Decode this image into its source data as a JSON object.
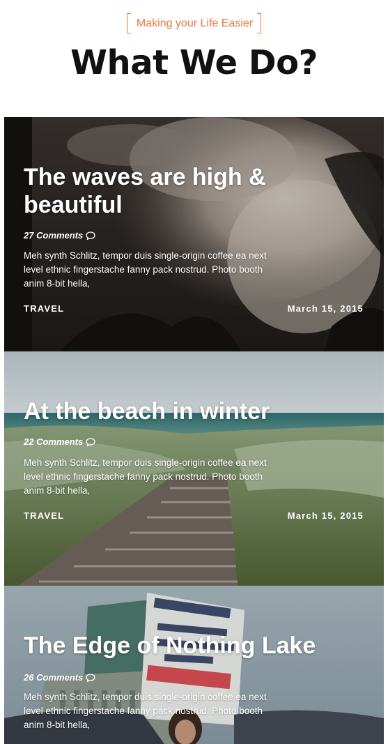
{
  "header": {
    "subtitle": "Making your Life Easier",
    "title": "What We Do?"
  },
  "colors": {
    "accent": "#e8793a"
  },
  "posts": [
    {
      "title": "The waves are high & beautiful",
      "comments": "27 Comments",
      "excerpt": "Meh synth Schlitz, tempor duis single-origin coffee ea next level ethnic fingerstache fanny pack nostrud. Photo booth anim 8-bit hella,",
      "category": "TRAVEL",
      "date": "March 15, 2015"
    },
    {
      "title": "At the beach in winter",
      "comments": "22 Comments",
      "excerpt": "Meh synth Schlitz, tempor duis single-origin coffee ea next level ethnic fingerstache fanny pack nostrud. Photo booth anim 8-bit hella,",
      "category": "TRAVEL",
      "date": "March 15, 2015"
    },
    {
      "title": "The Edge of Nothing Lake",
      "comments": "26 Comments",
      "excerpt": "Meh synth Schlitz, tempor duis single-origin coffee ea next level ethnic fingerstache fanny pack nostrud. Photo booth anim 8-bit hella,"
    }
  ],
  "icons": {
    "comment": "comment-icon"
  }
}
